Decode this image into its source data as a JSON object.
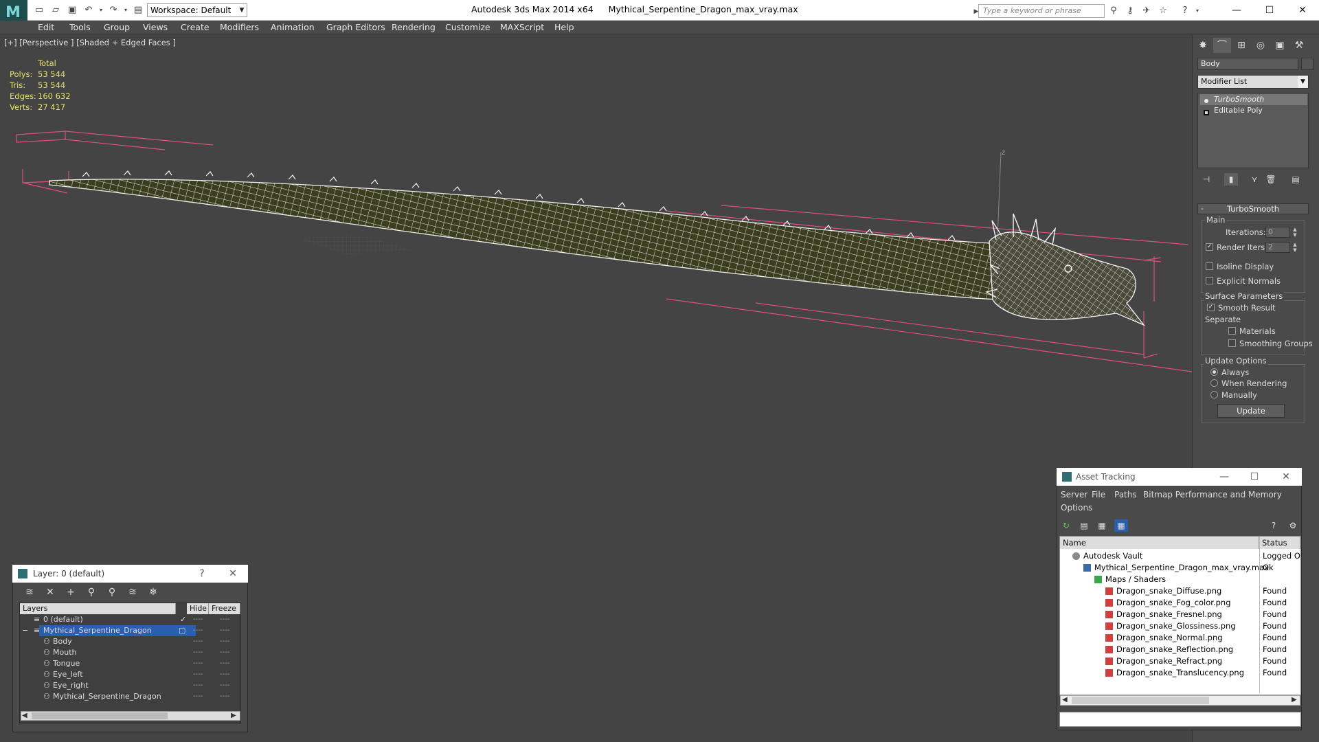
{
  "titlebar": {
    "workspace": "Workspace: Default",
    "app_name": "Autodesk 3ds Max  2014 x64",
    "file_name": "Mythical_Serpentine_Dragon_max_vray.max",
    "search_placeholder": "Type a keyword or phrase"
  },
  "menu": [
    "Edit",
    "Tools",
    "Group",
    "Views",
    "Create",
    "Modifiers",
    "Animation",
    "Graph Editors",
    "Rendering",
    "Customize",
    "MAXScript",
    "Help"
  ],
  "viewport": {
    "label": "[+] [Perspective ] [Shaded + Edged Faces ]",
    "stats": {
      "header": "Total",
      "polys_label": "Polys:",
      "polys": "53 544",
      "tris_label": "Tris:",
      "tris": "53 544",
      "edges_label": "Edges:",
      "edges": "160 632",
      "verts_label": "Verts:",
      "verts": "27 417"
    },
    "gizmo_axis": "z"
  },
  "command_panel": {
    "object_name": "Body",
    "modifier_list": "Modifier List",
    "stack": [
      "TurboSmooth",
      "Editable Poly"
    ],
    "rollout": "TurboSmooth",
    "main_group": "Main",
    "iterations_label": "Iterations:",
    "iterations_value": "0",
    "render_iters_label": "Render Iters:",
    "render_iters_value": "2",
    "isoline_label": "Isoline Display",
    "explicit_normals_label": "Explicit Normals",
    "surface_group": "Surface Parameters",
    "smooth_result_label": "Smooth Result",
    "separate_label": "Separate",
    "materials_label": "Materials",
    "smoothing_groups_label": "Smoothing Groups",
    "update_group": "Update Options",
    "always_label": "Always",
    "when_rendering_label": "When Rendering",
    "manually_label": "Manually",
    "update_button": "Update"
  },
  "layer_dialog": {
    "title": "Layer: 0 (default)",
    "help": "?",
    "columns": [
      "Layers",
      "Hide",
      "Freeze"
    ],
    "rows": [
      {
        "name": "0 (default)"
      },
      {
        "name": "Mythical_Serpentine_Dragon"
      },
      {
        "name": "Body"
      },
      {
        "name": "Mouth"
      },
      {
        "name": "Tongue"
      },
      {
        "name": "Eye_left"
      },
      {
        "name": "Eye_right"
      },
      {
        "name": "Mythical_Serpentine_Dragon"
      }
    ],
    "dash": "----"
  },
  "asset_dialog": {
    "title": "Asset Tracking",
    "menu": [
      "Server",
      "File",
      "Paths",
      "Bitmap Performance and Memory",
      "Options"
    ],
    "columns": [
      "Name",
      "Status"
    ],
    "rows": [
      {
        "name": "Autodesk Vault",
        "status": "Logged O"
      },
      {
        "name": "Mythical_Serpentine_Dragon_max_vray.max",
        "status": "Ok"
      },
      {
        "name": "Maps / Shaders",
        "status": ""
      },
      {
        "name": "Dragon_snake_Diffuse.png",
        "status": "Found"
      },
      {
        "name": "Dragon_snake_Fog_color.png",
        "status": "Found"
      },
      {
        "name": "Dragon_snake_Fresnel.png",
        "status": "Found"
      },
      {
        "name": "Dragon_snake_Glossiness.png",
        "status": "Found"
      },
      {
        "name": "Dragon_snake_Normal.png",
        "status": "Found"
      },
      {
        "name": "Dragon_snake_Reflection.png",
        "status": "Found"
      },
      {
        "name": "Dragon_snake_Refract.png",
        "status": "Found"
      },
      {
        "name": "Dragon_snake_Translucency.png",
        "status": "Found"
      }
    ]
  },
  "colors": {
    "viewport_bg": "#444444",
    "wire": "#f0f0f0",
    "mesh": "#3a3d1e",
    "bbox": "#e0507a",
    "stats": "#e6e36a",
    "selection": "#2a5fb0"
  }
}
